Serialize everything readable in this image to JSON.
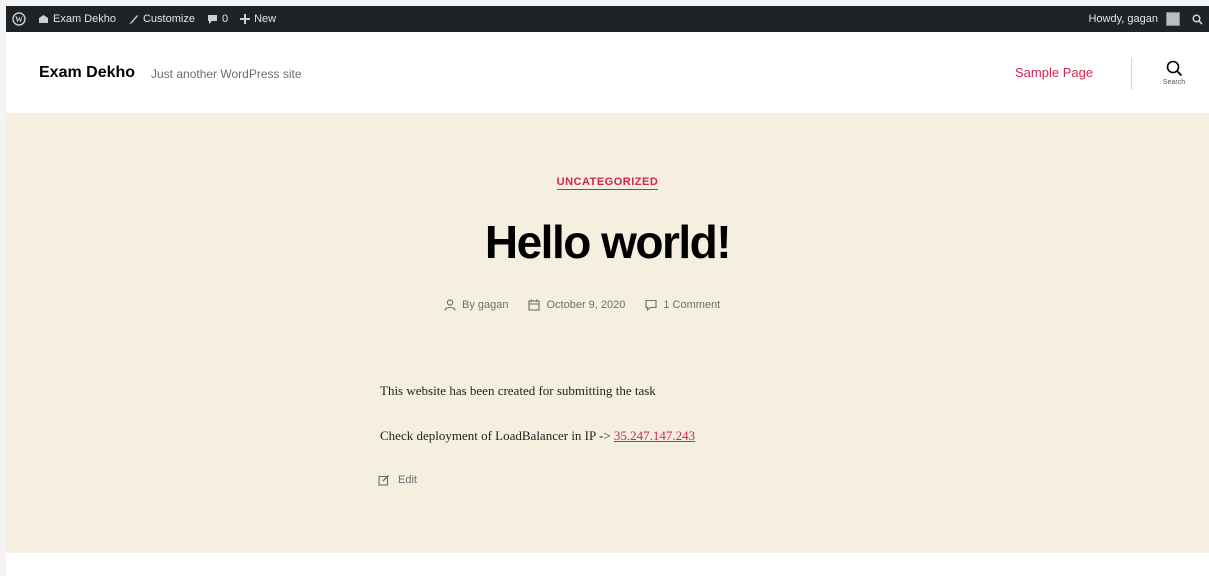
{
  "admin_bar": {
    "site_name": "Exam Dekho",
    "customize": "Customize",
    "comments_count": "0",
    "new": "New",
    "howdy": "Howdy, gagan"
  },
  "header": {
    "site_title": "Exam Dekho",
    "site_description": "Just another WordPress site",
    "nav_link": "Sample Page",
    "search_label": "Search"
  },
  "post": {
    "category": "UNCATEGORIZED",
    "title": "Hello world!",
    "author": "By gagan",
    "date": "October 9, 2020",
    "comments": "1 Comment",
    "paragraph1": "This website has been created for submitting the task",
    "paragraph2_prefix": "Check deployment of LoadBalancer in IP -> ",
    "ip_link": "35.247.147.243",
    "edit": "Edit"
  },
  "colors": {
    "accent": "#cd2653",
    "post_background": "#f5efe0",
    "admin_bar": "#1d2327"
  }
}
